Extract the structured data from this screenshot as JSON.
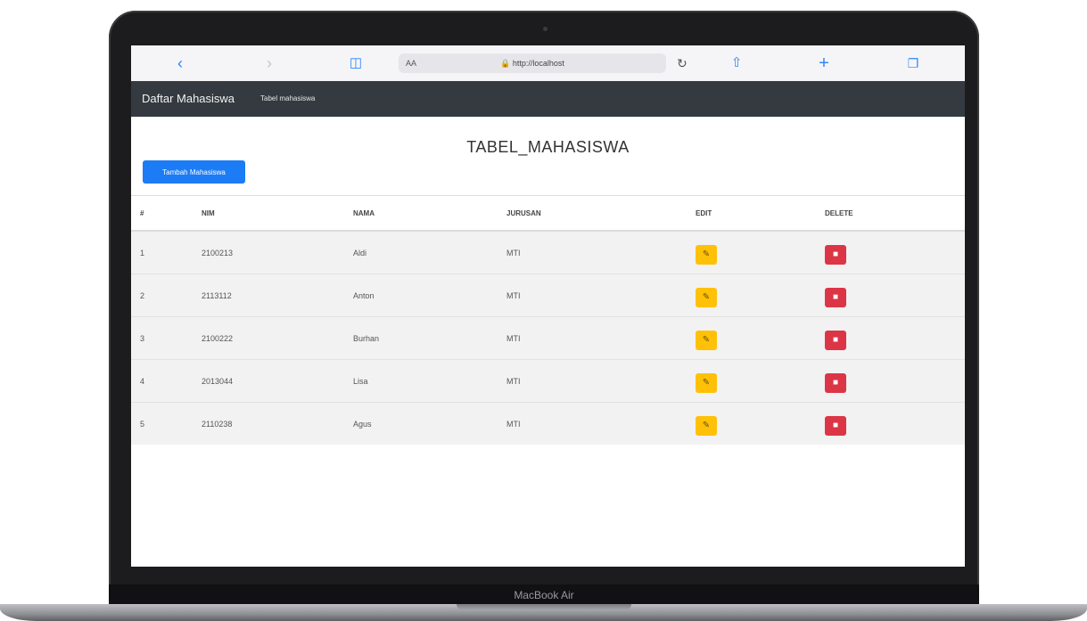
{
  "device": {
    "label": "MacBook Air"
  },
  "browser": {
    "address_aa": "AA",
    "url": "http://localhost"
  },
  "navbar": {
    "brand": "Daftar Mahasiswa",
    "link": "Tabel mahasiswa"
  },
  "page": {
    "title": "TABEL_MAHASISWA",
    "add_button": "Tambah Mahasiswa"
  },
  "table": {
    "headers": [
      "#",
      "NIM",
      "NAMA",
      "JURUSAN",
      "EDIT",
      "DELETE"
    ],
    "rows": [
      {
        "no": "1",
        "nim": "2100213",
        "nama": "Aldi",
        "jurusan": "MTI"
      },
      {
        "no": "2",
        "nim": "2113112",
        "nama": "Anton",
        "jurusan": "MTI"
      },
      {
        "no": "3",
        "nim": "2100222",
        "nama": "Burhan",
        "jurusan": "MTI"
      },
      {
        "no": "4",
        "nim": "2013044",
        "nama": "Lisa",
        "jurusan": "MTI"
      },
      {
        "no": "5",
        "nim": "2110238",
        "nama": "Agus",
        "jurusan": "MTI"
      }
    ]
  },
  "icons": {
    "back": "chevron-left-icon",
    "forward": "chevron-right-icon",
    "bookmarks": "book-icon",
    "lock": "lock-icon",
    "reload": "reload-icon",
    "share": "share-icon",
    "new_tab": "plus-icon",
    "tabs": "tabs-icon",
    "edit": "edit-icon",
    "delete": "trash-icon"
  },
  "colors": {
    "navbar": "#343a40",
    "primary": "#1b7cf5",
    "warning": "#fec107",
    "danger": "#dc3545"
  }
}
